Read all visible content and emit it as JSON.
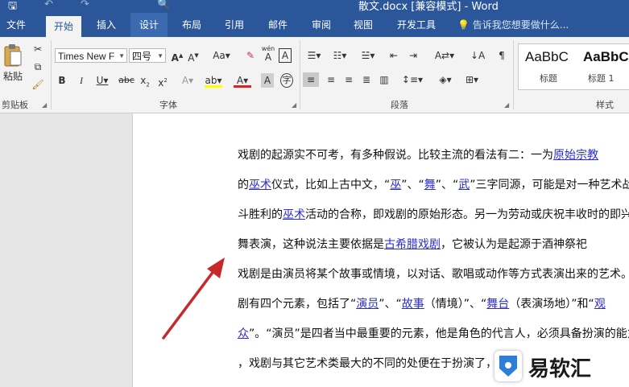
{
  "window": {
    "title": "散文.docx [兼容模式] - Word"
  },
  "menu": {
    "tabs": [
      "文件",
      "开始",
      "插入",
      "设计",
      "布局",
      "引用",
      "邮件",
      "审阅",
      "视图",
      "开发工具"
    ],
    "active": "开始",
    "tell_me": "告诉我您想要做什么..."
  },
  "ribbon": {
    "clipboard": {
      "paste_label": "粘贴",
      "group_label": "剪贴板"
    },
    "font": {
      "font_name": "Times New F",
      "font_size": "四号",
      "group_label": "字体",
      "pinyin_top": "wén",
      "pinyin_bottom": "A"
    },
    "paragraph": {
      "group_label": "段落"
    },
    "styles": {
      "group_label": "样式",
      "items": [
        {
          "preview": "AaBbC",
          "name": "标题"
        },
        {
          "preview": "AaBbC",
          "name": "标题 1"
        }
      ]
    }
  },
  "document": {
    "lines": [
      [
        {
          "t": "戏剧的起源实不可考，有多种假说。比较主流的看法有二：一为"
        },
        {
          "t": "原始宗教",
          "link": true
        }
      ],
      [
        {
          "t": "的"
        },
        {
          "t": "巫术",
          "link": true
        },
        {
          "t": "仪式，比如上古中文，“"
        },
        {
          "t": "巫",
          "link": true
        },
        {
          "t": "”、“"
        },
        {
          "t": "舞",
          "link": true
        },
        {
          "t": "”、“"
        },
        {
          "t": "武",
          "link": true
        },
        {
          "t": "”三字同源，可能是对一种艺术战"
        }
      ],
      [
        {
          "t": "斗胜利的"
        },
        {
          "t": "巫术",
          "link": true
        },
        {
          "t": "活动的合称，即戏剧的原始形态。另一为劳动或庆祝丰收时的即兴歌"
        }
      ],
      [
        {
          "t": "舞表演，这种说法主要依据是"
        },
        {
          "t": "古希腊戏剧",
          "link": true
        },
        {
          "t": "，它被认为是起源于酒神祭祀"
        }
      ],
      [
        {
          "t": "戏剧是由演员将某个故事或情境，以对话、歌唱或动作等方式表演出来的艺术。戏"
        }
      ],
      [
        {
          "t": "剧有四个元素，包括了“"
        },
        {
          "t": "演员",
          "link": true
        },
        {
          "t": "”、“"
        },
        {
          "t": "故事",
          "link": true
        },
        {
          "t": "（情境）”、“"
        },
        {
          "t": "舞台",
          "link": true
        },
        {
          "t": "（表演场地）”和“"
        },
        {
          "t": "观",
          "link": true
        }
      ],
      [
        {
          "t": "众",
          "link": true
        },
        {
          "t": "”。“演员”是四者当中最重要的元素，他是角色的代言人，必须具备扮演的能力"
        }
      ],
      [
        {
          "t": "，戏剧与其它艺术类最大的不同的处便在于扮演了，通"
        }
      ]
    ]
  },
  "watermark": {
    "brand": "易软汇"
  },
  "colors": {
    "word_blue": "#2b579a",
    "ribbon_bg": "#f3f3f3",
    "link": "#2b2bd0",
    "arrow": "#c8282a"
  }
}
